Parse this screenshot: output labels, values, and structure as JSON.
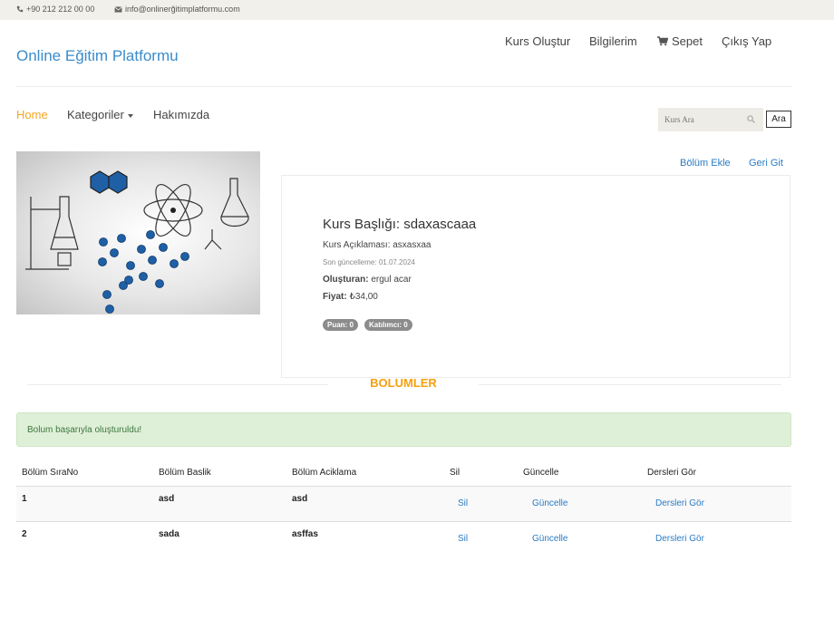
{
  "topbar": {
    "phone": "+90 212 212 00 00",
    "email": "info@onlinerğitimplatformu.com"
  },
  "brand": "Online Eğitim Platformu",
  "user_nav": {
    "create_course": "Kurs Oluştur",
    "my_info": "Bilgilerim",
    "cart": "Sepet",
    "logout": "Çıkış Yap"
  },
  "main_nav": {
    "home": "Home",
    "categories": "Kategoriler",
    "about": "Hakımızda"
  },
  "search": {
    "placeholder": "Kurs Ara",
    "button": "Ara"
  },
  "actions": {
    "add_section": "Bölüm Ekle",
    "go_back": "Geri Git"
  },
  "course": {
    "title": "Kurs Başlığı: sdaxascaaa",
    "description": "Kurs Açıklaması: asxasxaa",
    "updated": "Son güncelleme: 01.07.2024",
    "created_by_label": "Oluşturan:",
    "created_by_value": "ergul acar",
    "price_label": "Fiyat:",
    "price_value": "₺34,00",
    "rating": "Puan: 0",
    "participants": "Katılımcı: 0"
  },
  "section_title": "BOLUMLER",
  "alert": "Bolum başarıyla oluşturuldu!",
  "table": {
    "headers": [
      "Bölüm SıraNo",
      "Bölüm Baslik",
      "Bölüm Aciklama",
      "Sil",
      "Güncelle",
      "Dersleri Gör"
    ],
    "rows": [
      {
        "no": "1",
        "title": "asd",
        "desc": "asd",
        "delete": "Sil",
        "update": "Güncelle",
        "lessons": "Dersleri Gör"
      },
      {
        "no": "2",
        "title": "sada",
        "desc": "asffas",
        "delete": "Sil",
        "update": "Güncelle",
        "lessons": "Dersleri Gör"
      }
    ]
  },
  "colors": {
    "brand": "#3a8ccb",
    "active_nav": "#f5a623",
    "section_title": "#f5a00e",
    "link": "#2a7bc4",
    "alert_bg": "#dff0d8",
    "alert_text": "#3c763d",
    "badge": "#8c8c8c"
  },
  "icons": {
    "phone": "phone-icon",
    "email": "envelope-icon",
    "cart": "cart-icon",
    "search": "search-icon",
    "caret": "caret-down-icon"
  }
}
